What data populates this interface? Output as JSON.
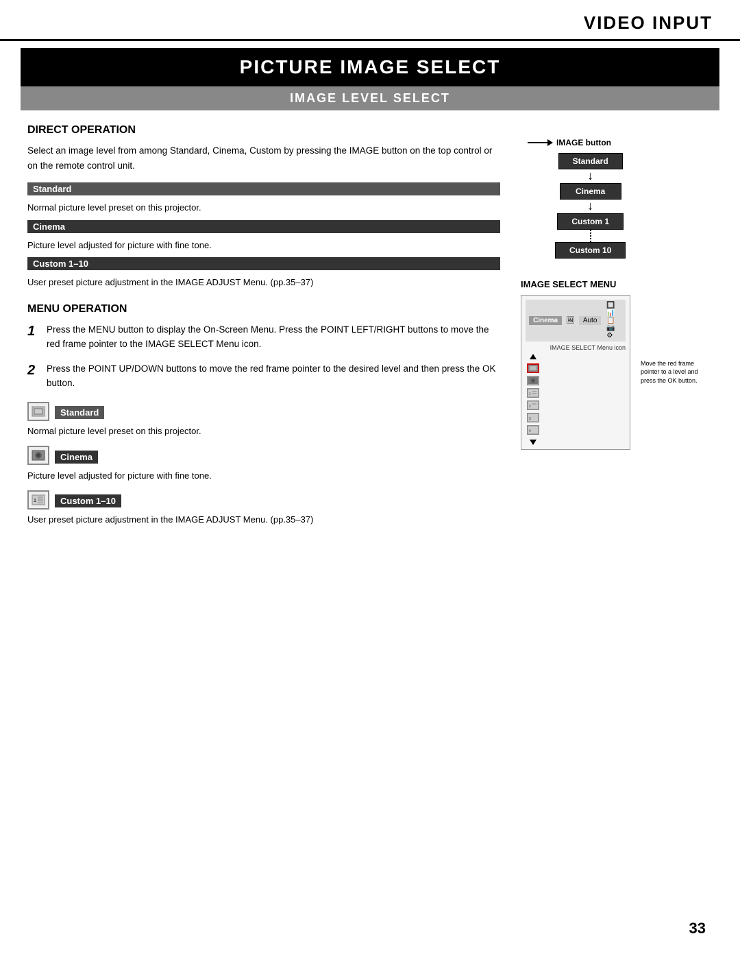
{
  "header": {
    "title": "VIDEO INPUT"
  },
  "main_title": "PICTURE IMAGE SELECT",
  "section_title": "IMAGE LEVEL SELECT",
  "direct_operation": {
    "heading": "DIRECT OPERATION",
    "intro": "Select an image level from among Standard, Cinema, Custom by pressing the IMAGE button on the top control or on the remote control unit.",
    "badges": [
      {
        "label": "Standard",
        "class": "badge-standard"
      },
      {
        "label": "Cinema",
        "class": "badge-cinema"
      },
      {
        "label": "Custom 1–10",
        "class": "badge-custom"
      }
    ],
    "descriptions": [
      "Normal picture level preset on this projector.",
      "Picture level adjusted for picture with fine tone.",
      "User preset picture adjustment in the IMAGE ADJUST Menu. (pp.35–37)"
    ]
  },
  "diagram": {
    "arrow_label": "IMAGE button",
    "boxes": [
      "Standard",
      "Cinema",
      "Custom 1",
      "Custom 10"
    ]
  },
  "menu_operation": {
    "heading": "MENU OPERATION",
    "steps": [
      "Press the MENU button to display the On-Screen Menu. Press the POINT LEFT/RIGHT buttons to move the red frame pointer to the IMAGE SELECT Menu icon.",
      "Press the POINT UP/DOWN buttons to move the red frame pointer to the desired level and then press the OK button."
    ],
    "menu_label": "IMAGE SELECT MENU",
    "icon_items": [
      {
        "label": "Standard",
        "class": "badge-standard",
        "desc": "Normal picture level preset on this projector."
      },
      {
        "label": "Cinema",
        "class": "badge-cinema",
        "desc": "Picture level adjusted for picture with fine tone."
      },
      {
        "label": "Custom 1–10",
        "class": "badge-custom",
        "desc": "User preset picture adjustment in the IMAGE ADJUST Menu. (pp.35–37)"
      }
    ],
    "annotation": "IMAGE SELECT Menu icon",
    "annotation2": "Move the red frame pointer to a level and press the OK button.",
    "menu_tab_label": "Cinema",
    "menu_tab2": "Auto"
  },
  "page_number": "33"
}
